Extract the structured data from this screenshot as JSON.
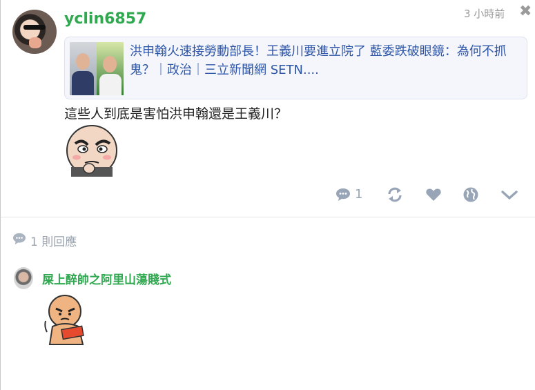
{
  "post": {
    "author": "yclin6857",
    "timestamp": "3 小時前",
    "close_symbol": "✖",
    "link_card": {
      "title": "洪申翰火速接勞動部長！王義川要進立院了 藍委跌破眼鏡：為何不抓鬼？｜政治｜三立新聞網 SETN...."
    },
    "text": "這些人到底是害怕洪申翰還是王義川？",
    "actions": {
      "comment_count": "1",
      "icons": [
        "comment-icon",
        "repost-icon",
        "heart-icon",
        "globe-icon",
        "chevron-down-icon"
      ]
    }
  },
  "replies": {
    "count_label": "1 則回應",
    "items": [
      {
        "author": "屎上醉帥之阿里山蕩賤式"
      }
    ]
  },
  "colors": {
    "username": "#2fa84f",
    "link": "#2e56a8",
    "icon": "#97a5b7",
    "meta": "#9a9a9a"
  }
}
